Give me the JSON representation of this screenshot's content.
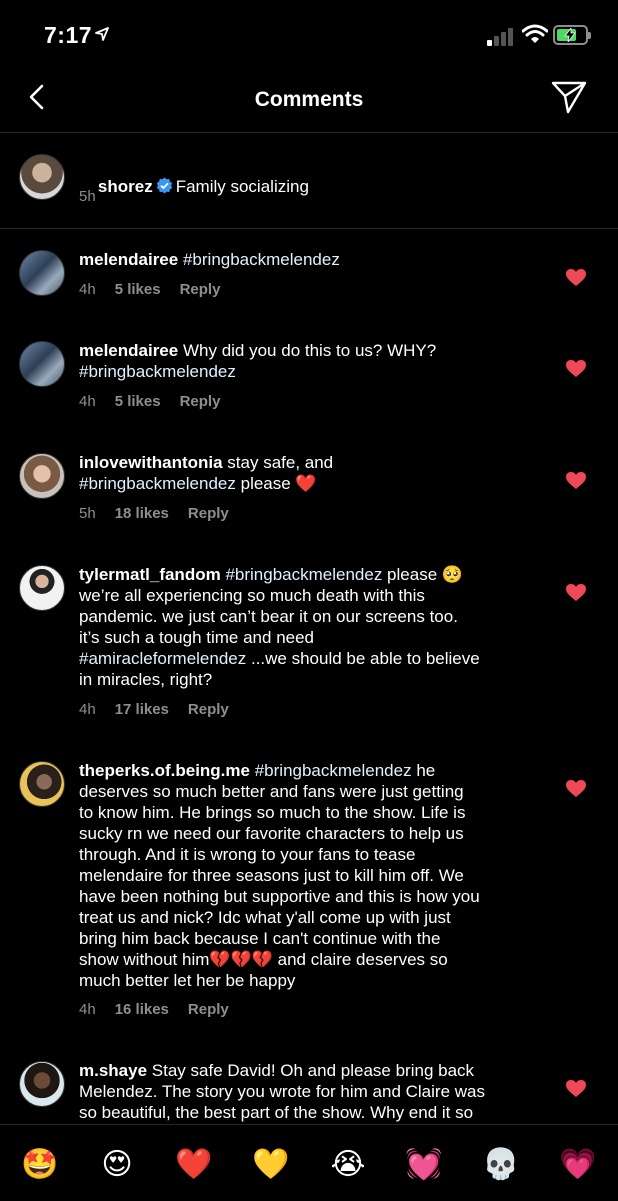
{
  "status": {
    "time": "7:17"
  },
  "header": {
    "title": "Comments"
  },
  "caption": {
    "username": "shorez",
    "text": "Family socializing",
    "time": "5h"
  },
  "comments": [
    {
      "username": "melendairee",
      "text": "#bringbackmelendez",
      "time": "4h",
      "likes": "5 likes",
      "reply": "Reply"
    },
    {
      "username": "melendairee",
      "text": "Why did you do this to us? WHY?\n#bringbackmelendez",
      "time": "4h",
      "likes": "5 likes",
      "reply": "Reply"
    },
    {
      "username": "inlovewithantonia",
      "text": "stay safe, and\n#bringbackmelendez please ❤️",
      "time": "5h",
      "likes": "18 likes",
      "reply": "Reply"
    },
    {
      "username": "tylermatl_fandom",
      "text": "#bringbackmelendez please 🥺\nwe’re all experiencing so much death with this\npandemic. we just can’t bear it on our screens too.\nit’s such a tough time and need\n#amiracleformelendez ...we should be able to believe\nin miracles, right?",
      "time": "4h",
      "likes": "17 likes",
      "reply": "Reply"
    },
    {
      "username": "theperks.of.being.me",
      "text": "#bringbackmelendez he\ndeserves so much better and fans were just getting\nto know him. He brings so much to the show. Life is\nsucky rn we need our favorite characters to help us\nthrough. And it is wrong to your fans to tease\nmelendaire for three seasons just to kill him off. We\nhave been nothing but supportive and this is how you\ntreat us and nick? Idc what y'all come up with just\nbring him back because I can't continue with the\nshow without him💔💔💔 and claire deserves so\nmuch better let her be happy",
      "time": "4h",
      "likes": "16 likes",
      "reply": "Reply"
    },
    {
      "username": "m.shaye",
      "text": "Stay safe David! Oh and please bring back\nMelendez. The story you wrote for him and Claire was\nso beautiful, the best part of the show. Why end it so",
      "time": "",
      "likes": "",
      "reply": ""
    }
  ],
  "reactions": [
    "🤩",
    "😍",
    "❤️",
    "💛",
    "😭",
    "💓",
    "💀",
    "💗"
  ],
  "colors": {
    "background": "#000000",
    "heart": "#ed4956",
    "muted": "#8e8e8e",
    "hashtag": "#e0f1ff",
    "verified": "#3897f0"
  }
}
